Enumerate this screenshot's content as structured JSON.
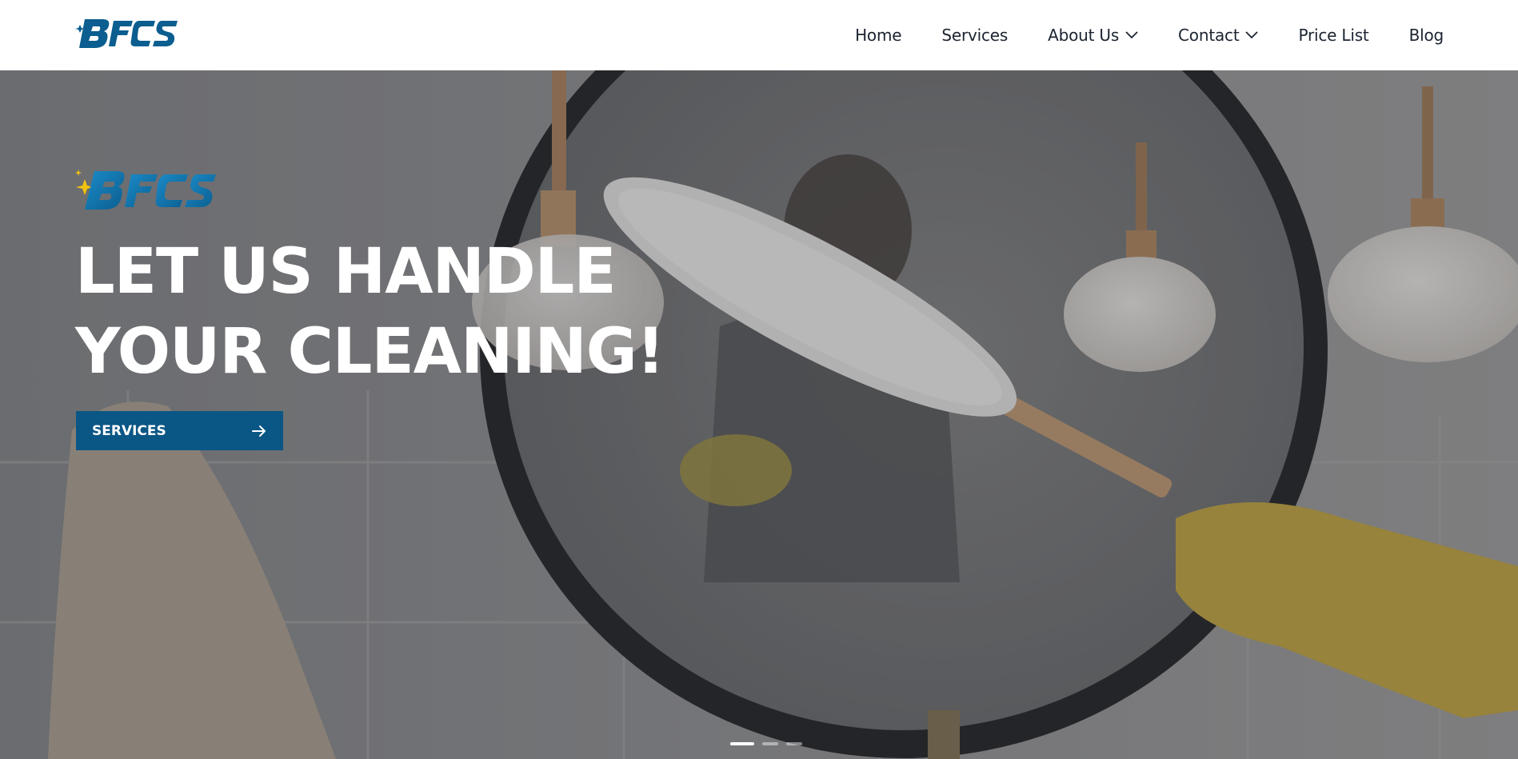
{
  "header": {
    "logo_text": "BFCS",
    "nav": [
      {
        "label": "Home",
        "has_dropdown": false
      },
      {
        "label": "Services",
        "has_dropdown": false
      },
      {
        "label": "About Us",
        "has_dropdown": true
      },
      {
        "label": "Contact",
        "has_dropdown": true
      },
      {
        "label": "Price List",
        "has_dropdown": false
      },
      {
        "label": "Blog",
        "has_dropdown": false
      }
    ]
  },
  "hero": {
    "logo_text": "BFCS",
    "headline_line1": "LET US HANDLE",
    "headline_line2": "YOUR CLEANING!",
    "button_label": "SERVICES",
    "button_icon": "arrow-right-icon",
    "slides_total": 3,
    "active_slide": 1
  },
  "colors": {
    "brand_blue": "#0a5685",
    "logo_blue": "#0b5e8f",
    "logo_star": "#f2c20f",
    "nav_text": "#1b2430",
    "hero_text": "#ffffff"
  }
}
